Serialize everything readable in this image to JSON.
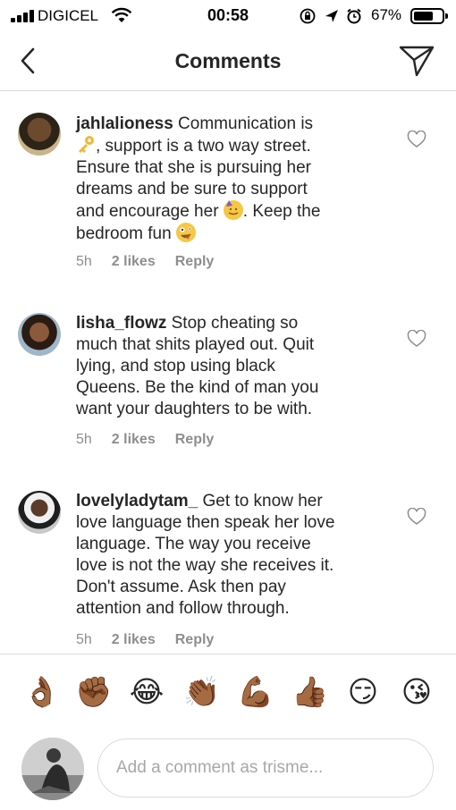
{
  "status_bar": {
    "carrier": "DIGICEL",
    "time": "00:58",
    "battery_percent": "67%",
    "icons": [
      "signal-icon",
      "wifi-icon",
      "orientation-lock-icon",
      "location-icon",
      "alarm-icon",
      "battery-icon"
    ]
  },
  "header": {
    "title": "Comments",
    "back_icon": "chevron-left-icon",
    "send_icon": "paper-plane-icon"
  },
  "comments": [
    {
      "username": "jahlalioness",
      "lines": [
        " Communication is",
        ", support is a two way street.",
        "Ensure that she is pursuing her",
        "dreams and be sure to support",
        "and encourage her ",
        ". Keep the",
        "bedroom fun "
      ],
      "emojis": [
        "key-emoji",
        "partying-face-emoji",
        "zany-face-emoji"
      ],
      "time": "5h",
      "likes": "2 likes",
      "reply": "Reply"
    },
    {
      "username": "lisha_flowz",
      "lines": [
        " Stop cheating so",
        "much that shits played out. Quit",
        "lying, and stop using black",
        "Queens. Be the kind of man you",
        "want your daughters to be with."
      ],
      "time": "5h",
      "likes": "2 likes",
      "reply": "Reply"
    },
    {
      "username": "lovelyladytam_",
      "lines": [
        " Get to know her",
        "love language then speak her love",
        "language. The way you receive",
        "love is not the way she receives it.",
        "Don't assume. Ask then pay",
        "attention and follow through."
      ],
      "time": "5h",
      "likes": "2 likes",
      "reply": "Reply"
    }
  ],
  "emoji_bar": [
    {
      "name": "ok-hand-emoji",
      "glyph": "👌🏾"
    },
    {
      "name": "raised-fist-emoji",
      "glyph": "✊🏾"
    },
    {
      "name": "tears-of-joy-emoji",
      "glyph": "😂"
    },
    {
      "name": "clapping-hands-emoji",
      "glyph": "👏🏾"
    },
    {
      "name": "flexed-biceps-emoji",
      "glyph": "💪🏾"
    },
    {
      "name": "thumbs-up-emoji",
      "glyph": "👍🏾"
    },
    {
      "name": "smirking-face-emoji",
      "glyph": "😏"
    },
    {
      "name": "face-blowing-kiss-emoji",
      "glyph": "😘"
    }
  ],
  "compose": {
    "placeholder": "Add a comment as trisme..."
  },
  "colors": {
    "text": "#262626",
    "secondary": "#8e8e8e",
    "divider": "#dbdbdb",
    "placeholder": "#a8a8a8"
  }
}
